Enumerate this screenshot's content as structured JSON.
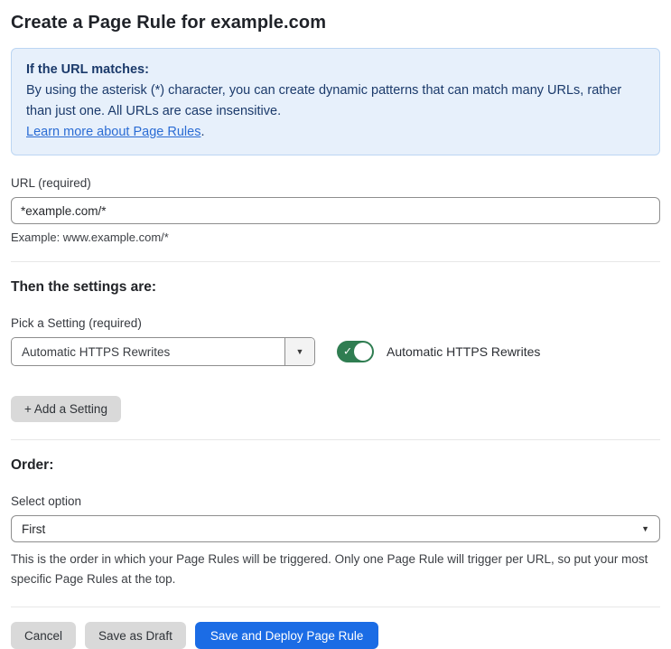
{
  "page": {
    "title": "Create a Page Rule for example.com"
  },
  "info_box": {
    "heading": "If the URL matches:",
    "body": "By using the asterisk (*) character, you can create dynamic patterns that can match many URLs, rather than just one. All URLs are case insensitive.",
    "link": "Learn more about Page Rules",
    "link_suffix": "."
  },
  "url_field": {
    "label": "URL (required)",
    "value": "*example.com/*",
    "helper": "Example: www.example.com/*"
  },
  "settings_section": {
    "heading": "Then the settings are:",
    "picker_label": "Pick a Setting (required)",
    "picker_value": "Automatic HTTPS Rewrites",
    "picker_arrow": "▼",
    "toggle_state": "on",
    "toggle_check": "✓",
    "toggle_label": "Automatic HTTPS Rewrites",
    "add_button_label": "+ Add a Setting"
  },
  "order_section": {
    "heading": "Order:",
    "select_label": "Select option",
    "select_value": "First",
    "select_arrow": "▼",
    "helper": "This is the order in which your Page Rules will be triggered. Only one Page Rule will trigger per URL, so put your most specific Page Rules at the top."
  },
  "footer": {
    "cancel_label": "Cancel",
    "save_draft_label": "Save as Draft",
    "save_deploy_label": "Save and Deploy Page Rule"
  },
  "colors": {
    "primary_blue": "#1b6ce5",
    "toggle_green": "#2f7d51",
    "info_bg": "#e7f0fb",
    "info_border": "#bcd6f3",
    "info_text": "#1b3a6b",
    "link_blue": "#2b6cd4"
  }
}
